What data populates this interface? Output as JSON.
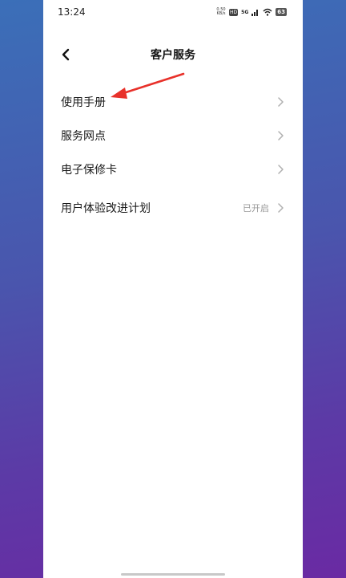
{
  "status_bar": {
    "time": "13:24",
    "net_speed_value": "0.50",
    "net_speed_unit": "KB/s",
    "hd_label": "HD",
    "network_label": "5G",
    "battery": "63"
  },
  "header": {
    "title": "客户服务"
  },
  "menu": {
    "items": [
      {
        "label": "使用手册",
        "value": ""
      },
      {
        "label": "服务网点",
        "value": ""
      },
      {
        "label": "电子保修卡",
        "value": ""
      },
      {
        "label": "用户体验改进计划",
        "value": "已开启"
      }
    ]
  },
  "colors": {
    "annotation_arrow": "#e8312a",
    "chevron": "#b0b0b0"
  }
}
